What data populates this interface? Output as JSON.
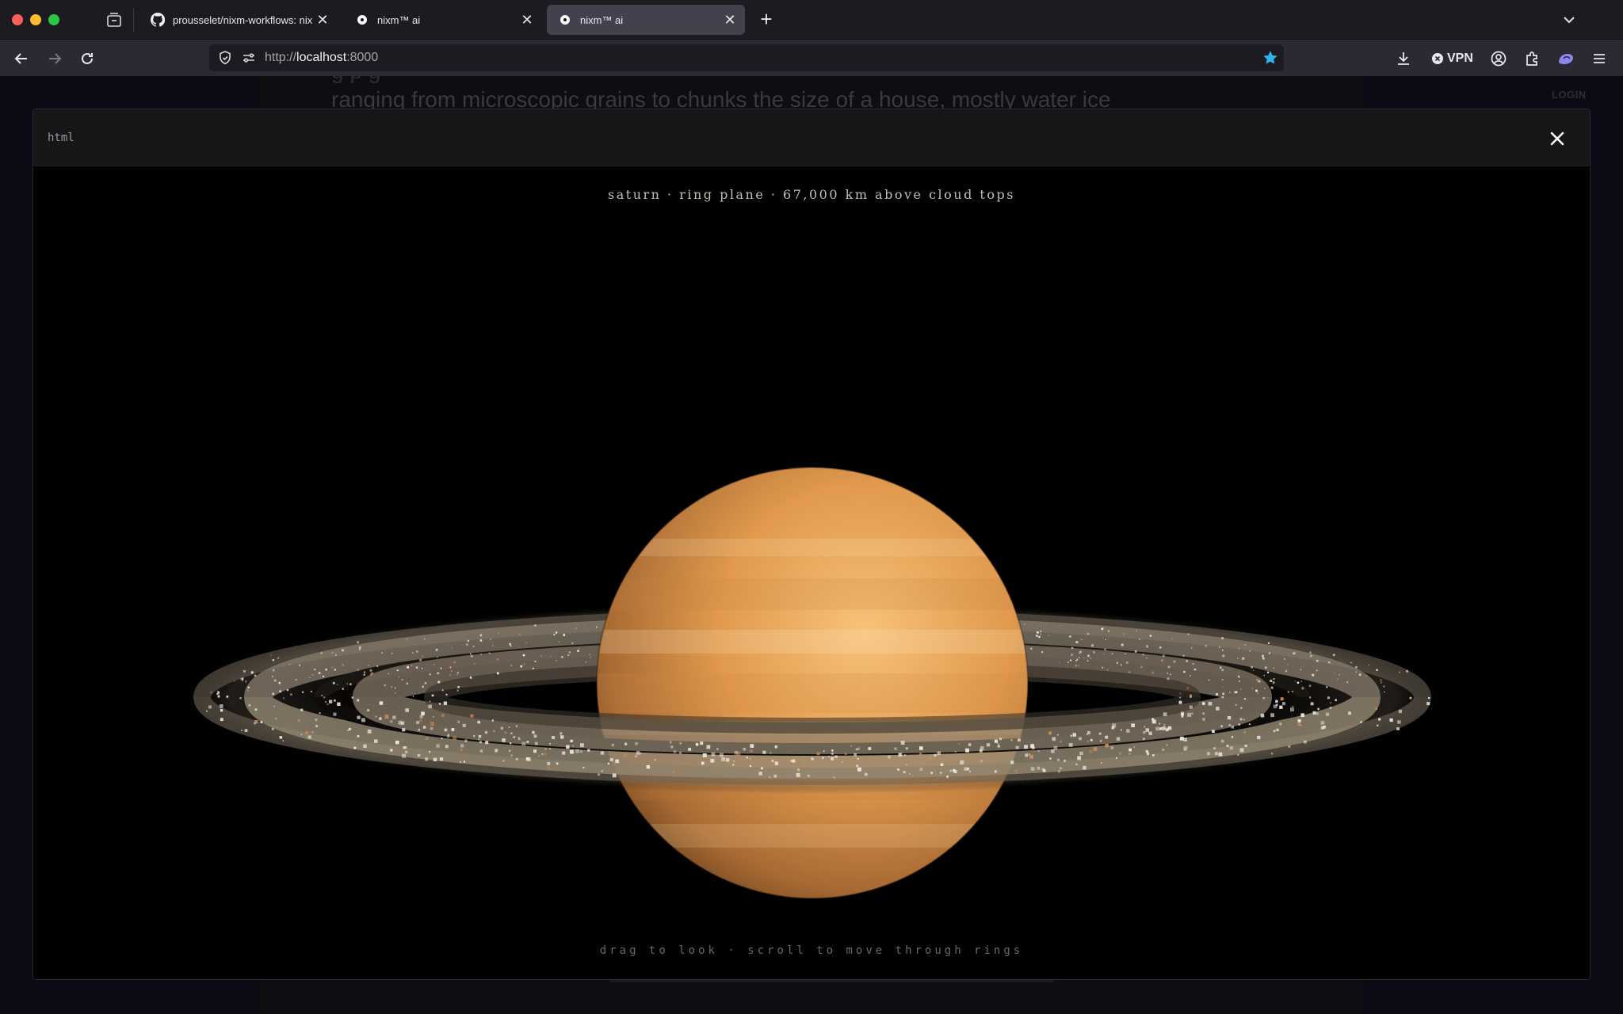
{
  "browser": {
    "tabs": [
      {
        "label": "prousselet/nixm-workflows: nixm",
        "active": false
      },
      {
        "label": "nixm™ ai",
        "active": false
      },
      {
        "label": "nixm™ ai",
        "active": true
      }
    ],
    "url_scheme": "http://",
    "url_host": "localhost",
    "url_port": ":8000",
    "vpn_label": "VPN",
    "accent_star": "#2ab5e6"
  },
  "background_page": {
    "text_line_top": "g    p                    g",
    "text_line": "ranging from microscopic grains to chunks the size of a house, mostly water ice",
    "login_label": "LOGIN"
  },
  "modal": {
    "language_label": "html",
    "caption": "saturn · ring plane · 67,000 km above cloud tops",
    "hint": "drag to look · scroll to move through rings",
    "colors": {
      "planet_light": "#f5b96a",
      "planet_dark": "#8a5a2a",
      "ring": "#b9a48a"
    }
  }
}
